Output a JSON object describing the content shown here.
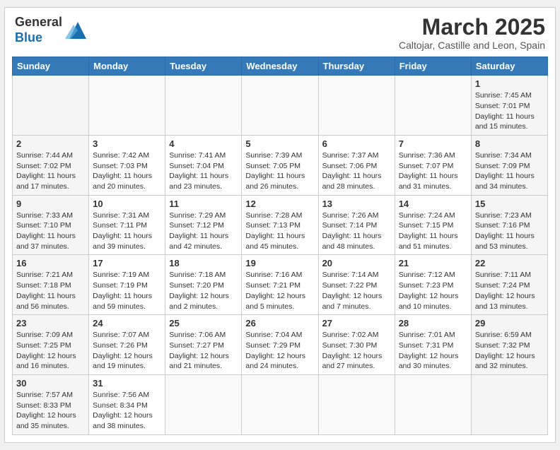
{
  "header": {
    "logo_line1": "General",
    "logo_line2": "Blue",
    "month_year": "March 2025",
    "location": "Caltojar, Castille and Leon, Spain"
  },
  "weekdays": [
    "Sunday",
    "Monday",
    "Tuesday",
    "Wednesday",
    "Thursday",
    "Friday",
    "Saturday"
  ],
  "weeks": [
    [
      {
        "day": "",
        "info": ""
      },
      {
        "day": "",
        "info": ""
      },
      {
        "day": "",
        "info": ""
      },
      {
        "day": "",
        "info": ""
      },
      {
        "day": "",
        "info": ""
      },
      {
        "day": "",
        "info": ""
      },
      {
        "day": "1",
        "info": "Sunrise: 7:45 AM\nSunset: 7:01 PM\nDaylight: 11 hours\nand 15 minutes."
      }
    ],
    [
      {
        "day": "2",
        "info": "Sunrise: 7:44 AM\nSunset: 7:02 PM\nDaylight: 11 hours\nand 17 minutes."
      },
      {
        "day": "3",
        "info": "Sunrise: 7:42 AM\nSunset: 7:03 PM\nDaylight: 11 hours\nand 20 minutes."
      },
      {
        "day": "4",
        "info": "Sunrise: 7:41 AM\nSunset: 7:04 PM\nDaylight: 11 hours\nand 23 minutes."
      },
      {
        "day": "5",
        "info": "Sunrise: 7:39 AM\nSunset: 7:05 PM\nDaylight: 11 hours\nand 26 minutes."
      },
      {
        "day": "6",
        "info": "Sunrise: 7:37 AM\nSunset: 7:06 PM\nDaylight: 11 hours\nand 28 minutes."
      },
      {
        "day": "7",
        "info": "Sunrise: 7:36 AM\nSunset: 7:07 PM\nDaylight: 11 hours\nand 31 minutes."
      },
      {
        "day": "8",
        "info": "Sunrise: 7:34 AM\nSunset: 7:09 PM\nDaylight: 11 hours\nand 34 minutes."
      }
    ],
    [
      {
        "day": "9",
        "info": "Sunrise: 7:33 AM\nSunset: 7:10 PM\nDaylight: 11 hours\nand 37 minutes."
      },
      {
        "day": "10",
        "info": "Sunrise: 7:31 AM\nSunset: 7:11 PM\nDaylight: 11 hours\nand 39 minutes."
      },
      {
        "day": "11",
        "info": "Sunrise: 7:29 AM\nSunset: 7:12 PM\nDaylight: 11 hours\nand 42 minutes."
      },
      {
        "day": "12",
        "info": "Sunrise: 7:28 AM\nSunset: 7:13 PM\nDaylight: 11 hours\nand 45 minutes."
      },
      {
        "day": "13",
        "info": "Sunrise: 7:26 AM\nSunset: 7:14 PM\nDaylight: 11 hours\nand 48 minutes."
      },
      {
        "day": "14",
        "info": "Sunrise: 7:24 AM\nSunset: 7:15 PM\nDaylight: 11 hours\nand 51 minutes."
      },
      {
        "day": "15",
        "info": "Sunrise: 7:23 AM\nSunset: 7:16 PM\nDaylight: 11 hours\nand 53 minutes."
      }
    ],
    [
      {
        "day": "16",
        "info": "Sunrise: 7:21 AM\nSunset: 7:18 PM\nDaylight: 11 hours\nand 56 minutes."
      },
      {
        "day": "17",
        "info": "Sunrise: 7:19 AM\nSunset: 7:19 PM\nDaylight: 11 hours\nand 59 minutes."
      },
      {
        "day": "18",
        "info": "Sunrise: 7:18 AM\nSunset: 7:20 PM\nDaylight: 12 hours\nand 2 minutes."
      },
      {
        "day": "19",
        "info": "Sunrise: 7:16 AM\nSunset: 7:21 PM\nDaylight: 12 hours\nand 5 minutes."
      },
      {
        "day": "20",
        "info": "Sunrise: 7:14 AM\nSunset: 7:22 PM\nDaylight: 12 hours\nand 7 minutes."
      },
      {
        "day": "21",
        "info": "Sunrise: 7:12 AM\nSunset: 7:23 PM\nDaylight: 12 hours\nand 10 minutes."
      },
      {
        "day": "22",
        "info": "Sunrise: 7:11 AM\nSunset: 7:24 PM\nDaylight: 12 hours\nand 13 minutes."
      }
    ],
    [
      {
        "day": "23",
        "info": "Sunrise: 7:09 AM\nSunset: 7:25 PM\nDaylight: 12 hours\nand 16 minutes."
      },
      {
        "day": "24",
        "info": "Sunrise: 7:07 AM\nSunset: 7:26 PM\nDaylight: 12 hours\nand 19 minutes."
      },
      {
        "day": "25",
        "info": "Sunrise: 7:06 AM\nSunset: 7:27 PM\nDaylight: 12 hours\nand 21 minutes."
      },
      {
        "day": "26",
        "info": "Sunrise: 7:04 AM\nSunset: 7:29 PM\nDaylight: 12 hours\nand 24 minutes."
      },
      {
        "day": "27",
        "info": "Sunrise: 7:02 AM\nSunset: 7:30 PM\nDaylight: 12 hours\nand 27 minutes."
      },
      {
        "day": "28",
        "info": "Sunrise: 7:01 AM\nSunset: 7:31 PM\nDaylight: 12 hours\nand 30 minutes."
      },
      {
        "day": "29",
        "info": "Sunrise: 6:59 AM\nSunset: 7:32 PM\nDaylight: 12 hours\nand 32 minutes."
      }
    ],
    [
      {
        "day": "30",
        "info": "Sunrise: 7:57 AM\nSunset: 8:33 PM\nDaylight: 12 hours\nand 35 minutes."
      },
      {
        "day": "31",
        "info": "Sunrise: 7:56 AM\nSunset: 8:34 PM\nDaylight: 12 hours\nand 38 minutes."
      },
      {
        "day": "",
        "info": ""
      },
      {
        "day": "",
        "info": ""
      },
      {
        "day": "",
        "info": ""
      },
      {
        "day": "",
        "info": ""
      },
      {
        "day": "",
        "info": ""
      }
    ]
  ]
}
